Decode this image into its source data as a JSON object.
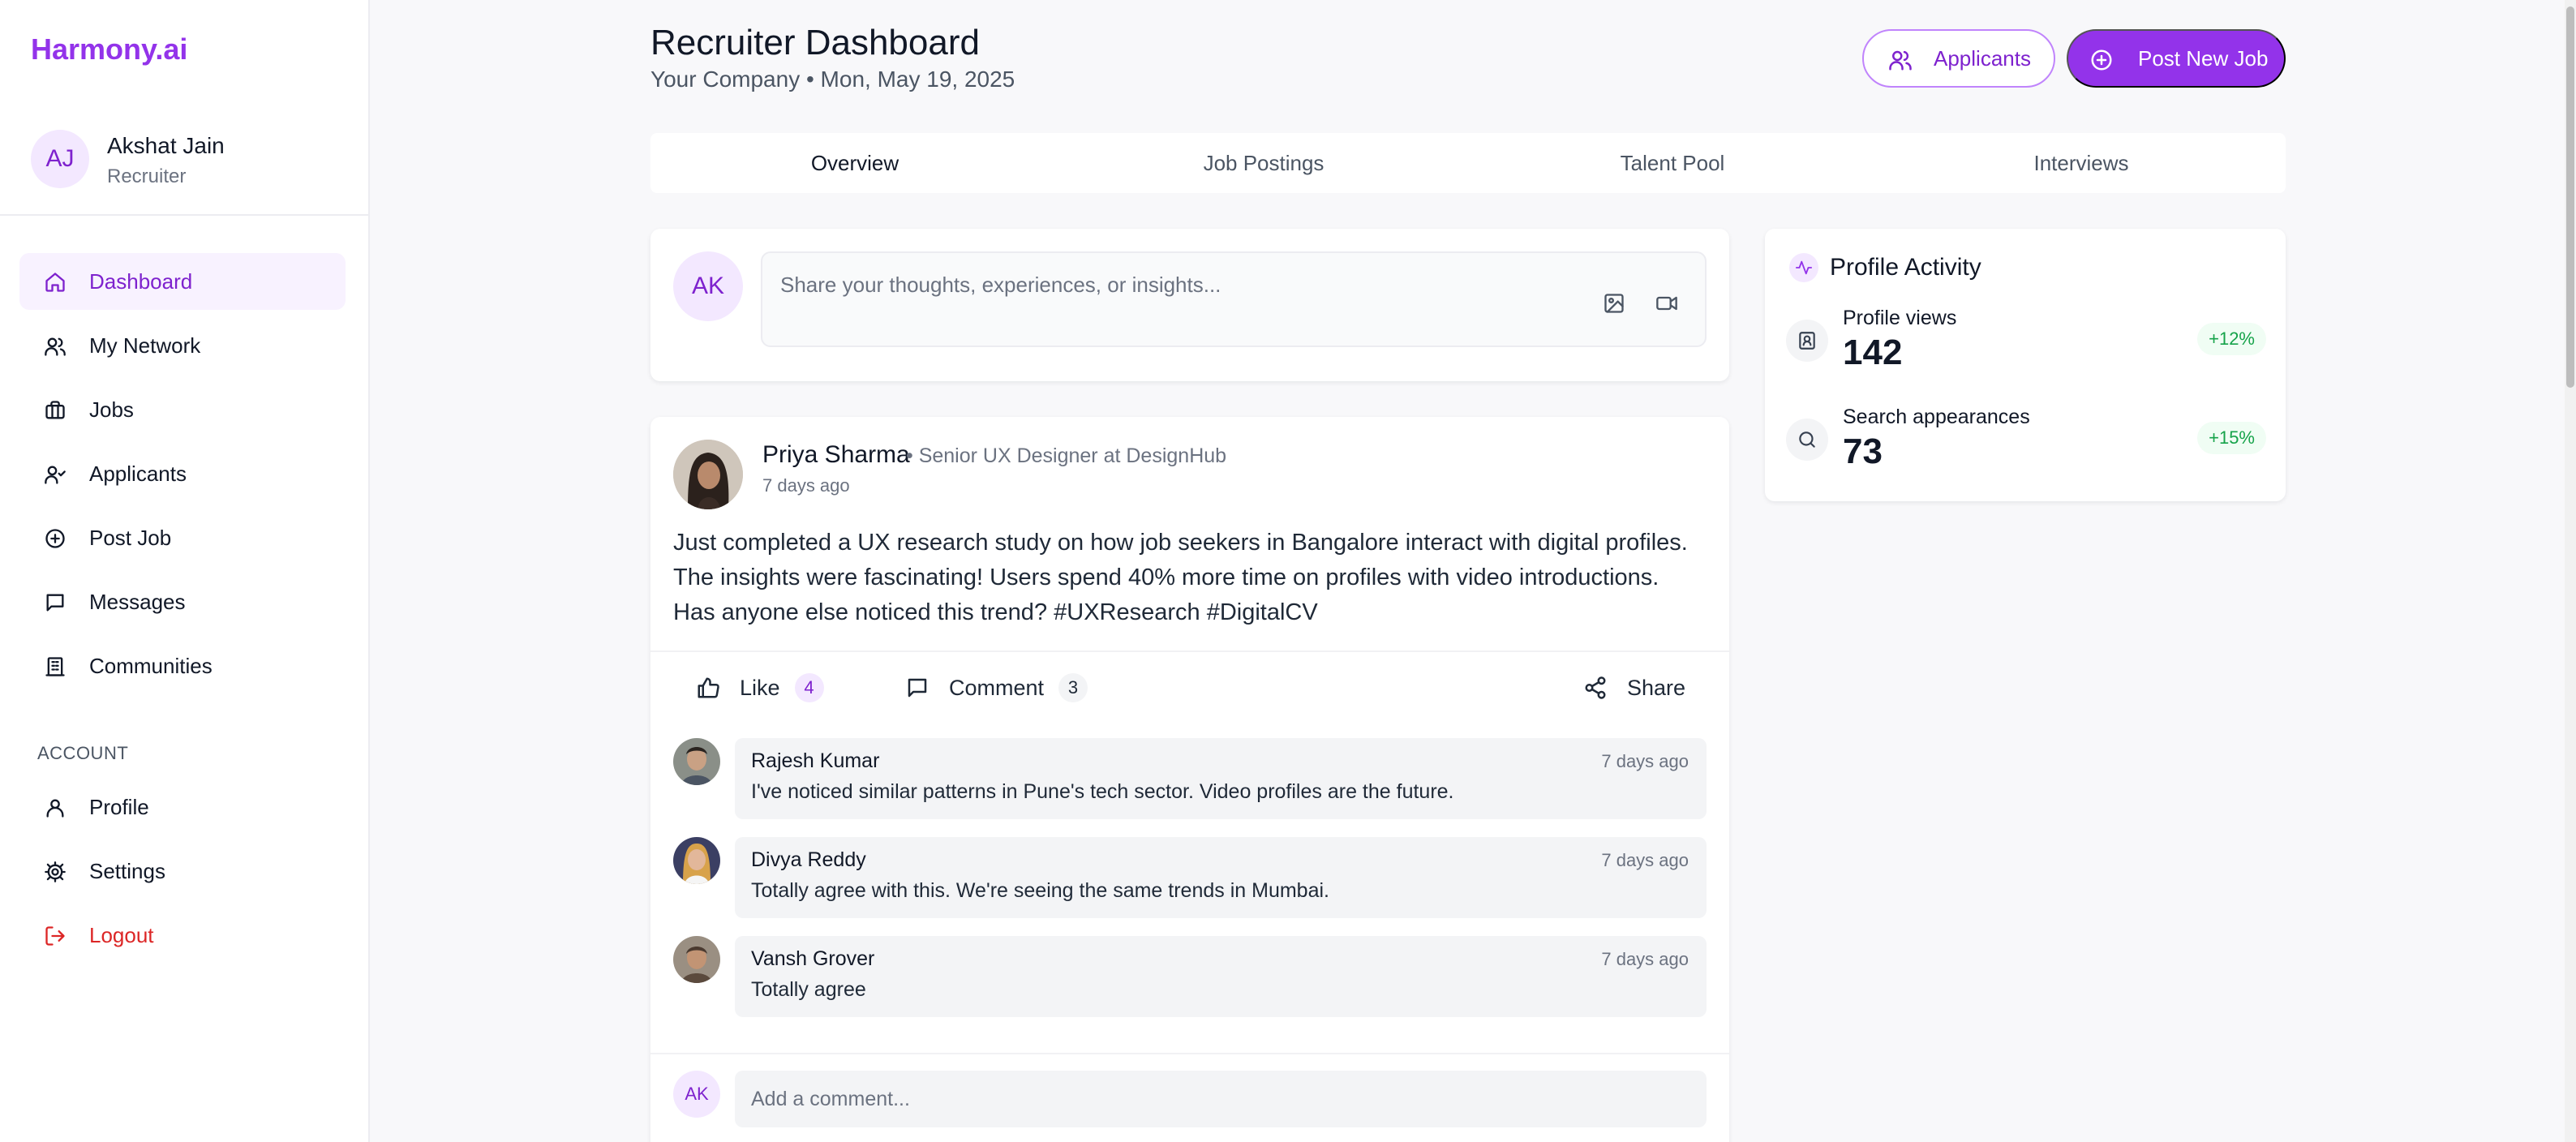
{
  "app": {
    "brand": "Harmony.ai"
  },
  "user": {
    "initials": "AJ",
    "name": "Akshat Jain",
    "role": "Recruiter"
  },
  "sidebar": {
    "items": [
      {
        "label": "Dashboard",
        "icon": "home-icon",
        "active": true
      },
      {
        "label": "My Network",
        "icon": "users-icon"
      },
      {
        "label": "Jobs",
        "icon": "briefcase-icon"
      },
      {
        "label": "Applicants",
        "icon": "user-check-icon"
      },
      {
        "label": "Post Job",
        "icon": "plus-circle-icon"
      },
      {
        "label": "Messages",
        "icon": "message-square-icon"
      },
      {
        "label": "Communities",
        "icon": "building-icon"
      }
    ],
    "account_label": "ACCOUNT",
    "account_items": [
      {
        "label": "Profile",
        "icon": "user-icon"
      },
      {
        "label": "Settings",
        "icon": "gear-icon"
      },
      {
        "label": "Logout",
        "icon": "logout-icon"
      }
    ]
  },
  "header": {
    "title": "Recruiter Dashboard",
    "subtitle": "Your Company • Mon, May 19, 2025",
    "applicants_button": "Applicants",
    "post_job_button": "Post New Job"
  },
  "tabs": [
    {
      "label": "Overview",
      "active": true
    },
    {
      "label": "Job Postings"
    },
    {
      "label": "Talent Pool"
    },
    {
      "label": "Interviews"
    }
  ],
  "composer": {
    "initials": "AK",
    "placeholder": "Share your thoughts, experiences, or insights..."
  },
  "post": {
    "author": "Priya Sharma",
    "role": "• Senior UX Designer at DesignHub",
    "time": "7 days ago",
    "body": "Just completed a UX research study on how job seekers in Bangalore interact with digital profiles. The insights were fascinating! Users spend 40% more time on profiles with video introductions. Has anyone else noticed this trend? #UXResearch #DigitalCV",
    "actions": {
      "like_label": "Like",
      "like_count": "4",
      "comment_label": "Comment",
      "comment_count": "3",
      "share_label": "Share"
    },
    "comments": [
      {
        "name": "Rajesh Kumar",
        "time": "7 days ago",
        "text": "I've noticed similar patterns in Pune's tech sector. Video profiles are the future."
      },
      {
        "name": "Divya Reddy",
        "time": "7 days ago",
        "text": "Totally agree with this. We're seeing the same trends in Mumbai."
      },
      {
        "name": "Vansh Grover",
        "time": "7 days ago",
        "text": "Totally agree"
      }
    ],
    "add_comment_initials": "AK",
    "add_comment_placeholder": "Add a comment..."
  },
  "activity": {
    "title": "Profile Activity",
    "metrics": [
      {
        "label": "Profile views",
        "value": "142",
        "delta": "+12%"
      },
      {
        "label": "Search appearances",
        "value": "73",
        "delta": "+15%"
      }
    ]
  },
  "colors": {
    "accent": "#9333ea",
    "accent_soft": "#f3e8ff",
    "danger": "#dc2626",
    "positive": "#16a34a"
  }
}
